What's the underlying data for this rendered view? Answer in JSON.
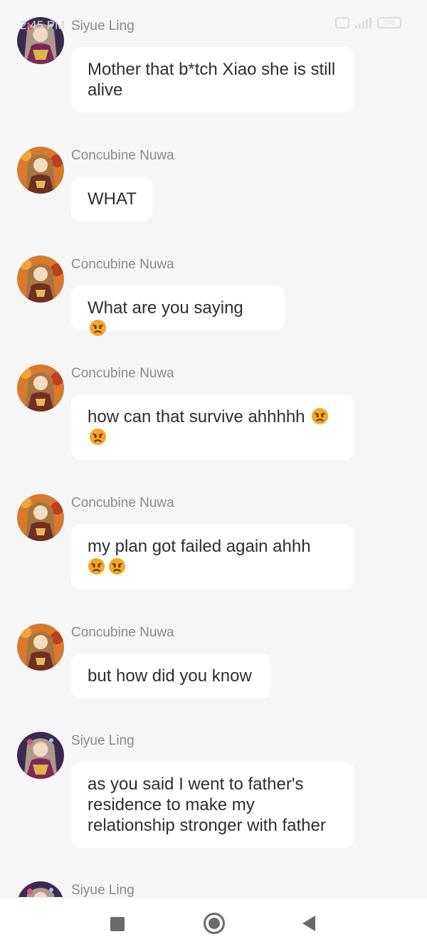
{
  "status_bar": {
    "time": "2:45 PM",
    "battery": "100"
  },
  "messages": [
    {
      "sender": "Siyue Ling",
      "text": "Mother that b*tch Xiao she is still alive",
      "avatar": "avatar-siyue"
    },
    {
      "sender": "Concubine Nuwa",
      "text": "WHAT",
      "avatar": "avatar-nuwa"
    },
    {
      "sender": "Concubine Nuwa",
      "text": "What are you saying",
      "emoji": [
        "angry-face-emoji"
      ],
      "avatar": "avatar-nuwa"
    },
    {
      "sender": "Concubine Nuwa",
      "text": "how can that survive ahhhhh",
      "emoji": [
        "angry-face-emoji",
        "angry-face-emoji"
      ],
      "avatar": "avatar-nuwa"
    },
    {
      "sender": "Concubine Nuwa",
      "text": "my plan got failed again ahhh",
      "emoji": [
        "angry-face-emoji",
        "angry-face-emoji"
      ],
      "avatar": "avatar-nuwa"
    },
    {
      "sender": "Concubine Nuwa",
      "text": "but how did you know",
      "avatar": "avatar-nuwa"
    },
    {
      "sender": "Siyue Ling",
      "text": "as you said I went to father's residence to make my relationship stronger with father",
      "avatar": "avatar-siyue"
    },
    {
      "sender": "Siyue Ling",
      "text": "",
      "avatar": "avatar-siyue"
    }
  ],
  "nav": {
    "icons": [
      "recent-apps-icon",
      "home-icon",
      "back-icon"
    ]
  },
  "colors": {
    "background": "#f6f6f6",
    "bubble": "#ffffff",
    "sender_name": "#8a8a8a",
    "message_text": "#2e2e2e",
    "emoji": "#f5a623"
  }
}
